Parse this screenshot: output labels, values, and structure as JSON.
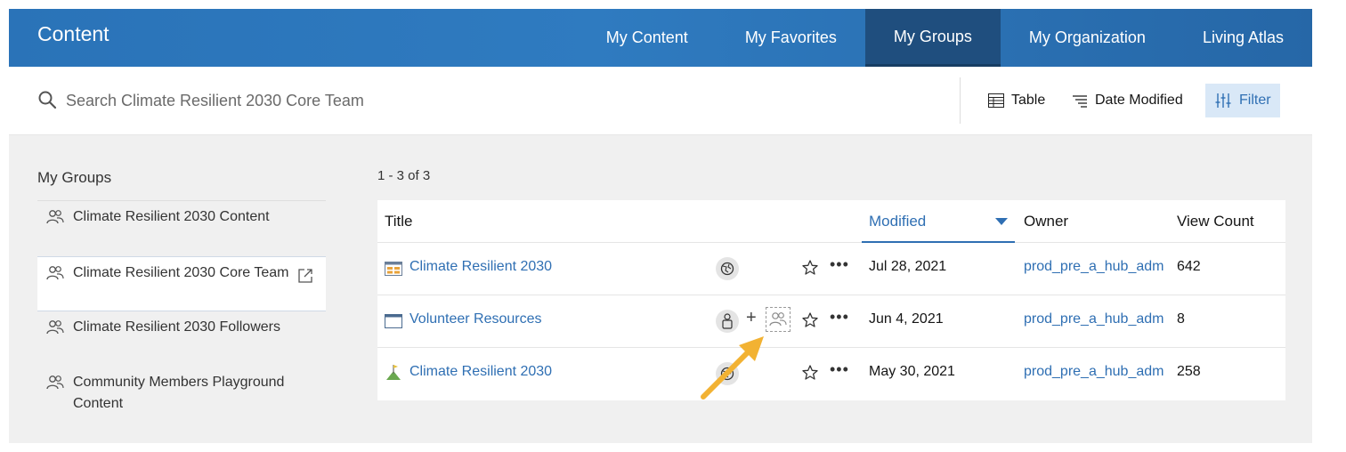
{
  "header": {
    "title": "Content",
    "tabs": [
      {
        "label": "My Content",
        "active": false
      },
      {
        "label": "My Favorites",
        "active": false
      },
      {
        "label": "My Groups",
        "active": true
      },
      {
        "label": "My Organization",
        "active": false
      },
      {
        "label": "Living Atlas",
        "active": false
      }
    ]
  },
  "search": {
    "placeholder": "Search Climate Resilient 2030 Core Team",
    "value": ""
  },
  "toolbar": {
    "table_label": "Table",
    "sort_label": "Date Modified",
    "filter_label": "Filter"
  },
  "sidebar": {
    "title": "My Groups",
    "items": [
      {
        "label": "Climate Resilient 2030 Content",
        "active": false
      },
      {
        "label": "Climate Resilient 2030 Core Team",
        "active": true
      },
      {
        "label": "Climate Resilient 2030 Followers",
        "active": false
      },
      {
        "label": "Community Members Playground Content",
        "active": false
      }
    ]
  },
  "results": {
    "count_text": "1 - 3 of 3",
    "columns": {
      "title": "Title",
      "modified": "Modified",
      "owner": "Owner",
      "views": "View Count"
    },
    "rows": [
      {
        "type_icon": "dashboard-icon",
        "title": "Climate Resilient 2030",
        "sharing": "public-globe-icon",
        "modified": "Jul 28, 2021",
        "owner": "prod_pre_a_hub_adm",
        "views": "642"
      },
      {
        "type_icon": "web-app-icon",
        "title": "Volunteer Resources",
        "sharing": "private-lock-icon",
        "modified": "Jun 4, 2021",
        "owner": "prod_pre_a_hub_adm",
        "views": "8"
      },
      {
        "type_icon": "site-flag-icon",
        "title": "Climate Resilient 2030",
        "sharing": "public-globe-icon",
        "modified": "May 30, 2021",
        "owner": "prod_pre_a_hub_adm",
        "views": "258"
      }
    ]
  },
  "colors": {
    "header_blue": "#2f7bc0",
    "active_tab": "#1f4e7e",
    "link_blue": "#2f6fb3",
    "annotation_arrow": "#f2b233"
  }
}
